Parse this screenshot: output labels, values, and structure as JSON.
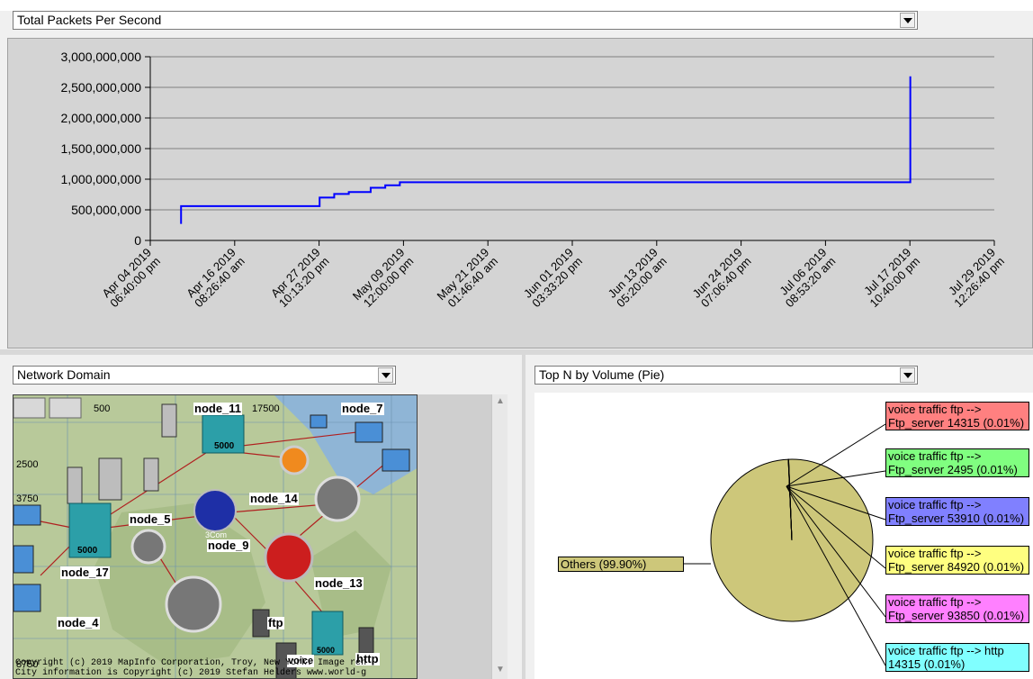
{
  "metric_selector": {
    "value": "Total Packets Per Second"
  },
  "left_selector": {
    "value": "Network Domain"
  },
  "right_selector": {
    "value": "Top N by Volume (Pie)"
  },
  "chart_data": [
    {
      "type": "line",
      "title": "",
      "xlabel": "",
      "ylabel": "",
      "ylim": [
        0,
        3000000000
      ],
      "yticks": [
        "3,000,000,000",
        "2,500,000,000",
        "2,000,000,000",
        "1,500,000,000",
        "1,000,000,000",
        "500,000,000",
        "0"
      ],
      "xticks": [
        "Apr 04 2019\n06:40:00 pm",
        "Apr 16 2019\n08:26:40 am",
        "Apr 27 2019\n10:13:20 pm",
        "May 09 2019\n12:00:00 pm",
        "May 21 2019\n01:46:40 am",
        "Jun 01 2019\n03:33:20 pm",
        "Jun 13 2019\n05:20:00 am",
        "Jun 24 2019\n07:06:40 pm",
        "Jul 06 2019\n08:53:20 am",
        "Jul 17 2019\n10:40:00 pm",
        "Jul 29 2019\n12:26:40 pm"
      ],
      "grid": "horizontal",
      "series": [
        {
          "color": "#0000ff",
          "x": [
            "2019-04-09",
            "2019-04-09",
            "2019-04-27",
            "2019-04-28",
            "2019-04-30",
            "2019-05-02",
            "2019-05-05",
            "2019-05-07",
            "2019-05-09",
            "2019-07-17",
            "2019-07-18",
            "2019-07-18"
          ],
          "values": [
            270000000,
            560000000,
            560000000,
            700000000,
            760000000,
            790000000,
            860000000,
            900000000,
            950000000,
            950000000,
            1010000000,
            2680000000
          ]
        }
      ]
    },
    {
      "type": "pie",
      "slices": [
        {
          "label": "Others (99.90%)",
          "value": 99.9,
          "color": "#cdc77a"
        },
        {
          "label": "voice traffic ftp --> Ftp_server 14315 (0.01%)",
          "value": 0.01,
          "color": "#ff8080"
        },
        {
          "label": "voice traffic ftp --> Ftp_server 2495 (0.01%)",
          "value": 0.01,
          "color": "#80ff80"
        },
        {
          "label": "voice traffic ftp --> Ftp_server 53910 (0.01%)",
          "value": 0.01,
          "color": "#8080ff"
        },
        {
          "label": "voice traffic ftp --> Ftp_server 84920 (0.01%)",
          "value": 0.01,
          "color": "#ffff80"
        },
        {
          "label": "voice traffic ftp --> Ftp_server 93850 (0.01%)",
          "value": 0.01,
          "color": "#ff80ff"
        },
        {
          "label": "voice traffic ftp --> http 14315 (0.01%)",
          "value": 0.01,
          "color": "#80ffff"
        }
      ]
    }
  ],
  "map": {
    "nodes": [
      "node_11",
      "node_7",
      "node_14",
      "node_5",
      "node_9",
      "node_13",
      "node_17",
      "node_4",
      "ftp",
      "http",
      "voice"
    ],
    "device_labels": [
      "3Com",
      "5000",
      "5000",
      "5000"
    ],
    "scale_labels": [
      "500",
      "17500",
      "2500",
      "3750",
      "8750"
    ],
    "copyright_line1": "Copyright (c) 2019 MapInfo Corporation, Troy, New York. Image ren",
    "copyright_line2": "City information is Copyright (c) 2019 Stefan Helders www.world-g"
  }
}
